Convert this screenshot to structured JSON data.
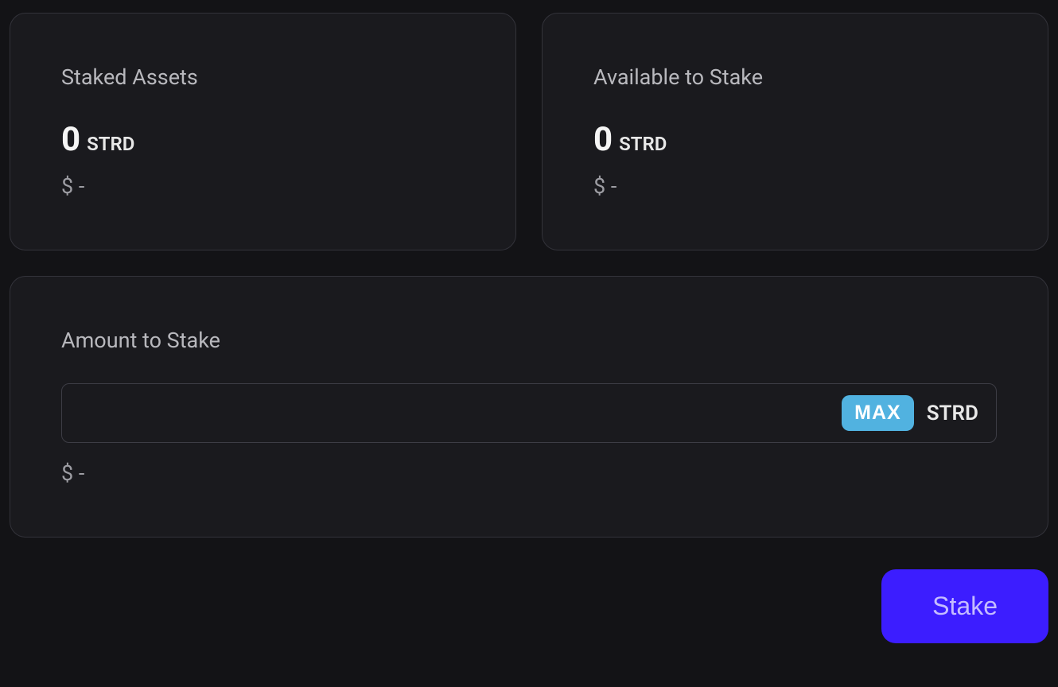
{
  "staked_assets": {
    "title": "Staked Assets",
    "amount": "0",
    "currency": "STRD",
    "dollar_value": "$ -"
  },
  "available": {
    "title": "Available to Stake",
    "amount": "0",
    "currency": "STRD",
    "dollar_value": "$ -"
  },
  "stake_form": {
    "title": "Amount to Stake",
    "max_label": "MAX",
    "currency": "STRD",
    "dollar_value": "$ -",
    "input_value": ""
  },
  "buttons": {
    "stake": "Stake"
  }
}
